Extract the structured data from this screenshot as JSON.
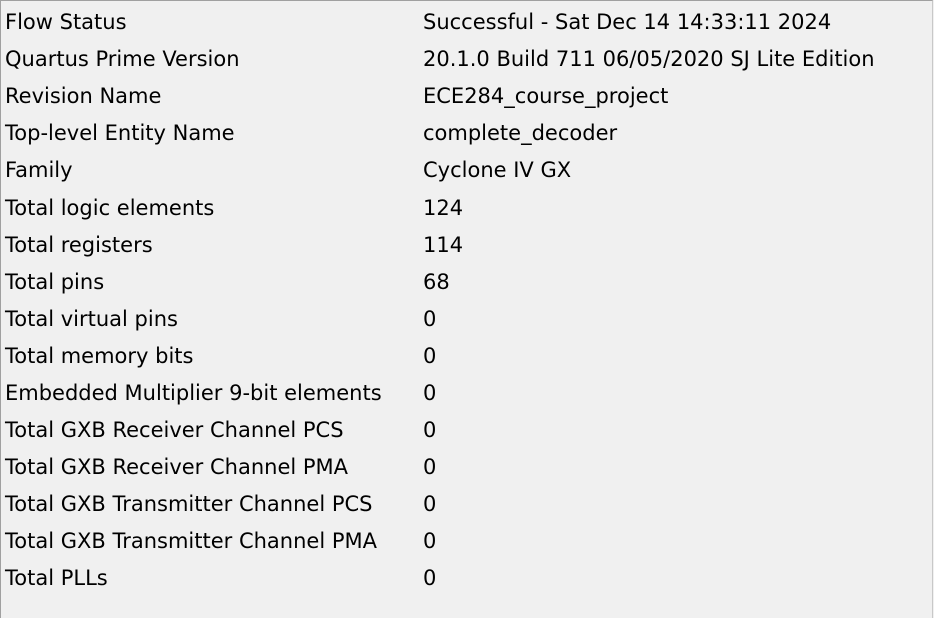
{
  "flow_summary": {
    "rows": [
      {
        "label": "Flow Status",
        "value": "Successful - Sat Dec 14 14:33:11 2024"
      },
      {
        "label": "Quartus Prime Version",
        "value": "20.1.0 Build 711 06/05/2020 SJ Lite Edition"
      },
      {
        "label": "Revision Name",
        "value": "ECE284_course_project"
      },
      {
        "label": "Top-level Entity Name",
        "value": "complete_decoder"
      },
      {
        "label": "Family",
        "value": "Cyclone IV GX"
      },
      {
        "label": "Total logic elements",
        "value": "124"
      },
      {
        "label": "Total registers",
        "value": "114"
      },
      {
        "label": "Total pins",
        "value": "68"
      },
      {
        "label": "Total virtual pins",
        "value": "0"
      },
      {
        "label": "Total memory bits",
        "value": "0"
      },
      {
        "label": "Embedded Multiplier 9-bit elements",
        "value": "0"
      },
      {
        "label": "Total GXB Receiver Channel PCS",
        "value": "0"
      },
      {
        "label": "Total GXB Receiver Channel PMA",
        "value": "0"
      },
      {
        "label": "Total GXB Transmitter Channel PCS",
        "value": "0"
      },
      {
        "label": "Total GXB Transmitter Channel PMA",
        "value": "0"
      },
      {
        "label": "Total PLLs",
        "value": "0"
      }
    ]
  }
}
